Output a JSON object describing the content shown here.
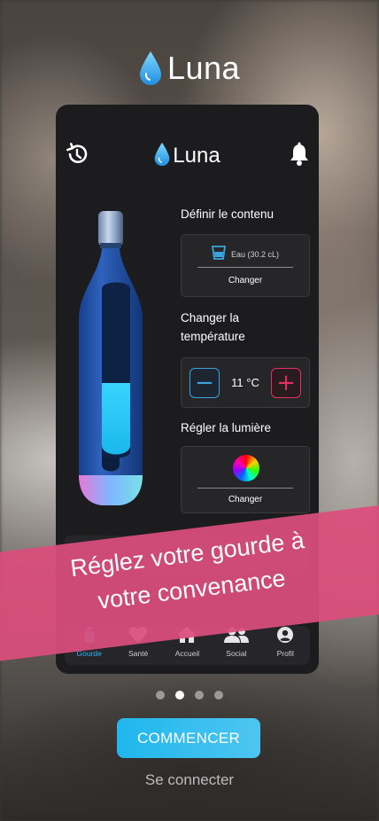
{
  "app": {
    "brand": "Luna",
    "accent_color": "#2bb5f0",
    "highlight_color": "#dc4d7d"
  },
  "phone": {
    "header": {
      "brand": "Luna",
      "left_icon": "history-icon",
      "right_icon": "bell-icon"
    },
    "content": {
      "title": "Définir le contenu",
      "value": "Eau (30.2 cL)",
      "button": "Changer"
    },
    "temperature": {
      "title_line1": "Changer la",
      "title_line2": "température",
      "value": "11 °C",
      "minus": "−",
      "plus": "+"
    },
    "light": {
      "title": "Régler la lumière",
      "button": "Changer"
    },
    "nav": [
      {
        "label": "Gourde",
        "icon": "bottle-icon",
        "active": true
      },
      {
        "label": "Santé",
        "icon": "heart-icon",
        "active": false
      },
      {
        "label": "Accueil",
        "icon": "home-icon",
        "active": false
      },
      {
        "label": "Social",
        "icon": "users-icon",
        "active": false
      },
      {
        "label": "Profil",
        "icon": "profile-icon",
        "active": false
      }
    ]
  },
  "banner": {
    "line1": "Réglez votre gourde à",
    "line2": "votre convenance"
  },
  "pager": {
    "count": 4,
    "active_index": 1
  },
  "cta": {
    "label": "COMMENCER"
  },
  "login": {
    "label": "Se connecter"
  }
}
